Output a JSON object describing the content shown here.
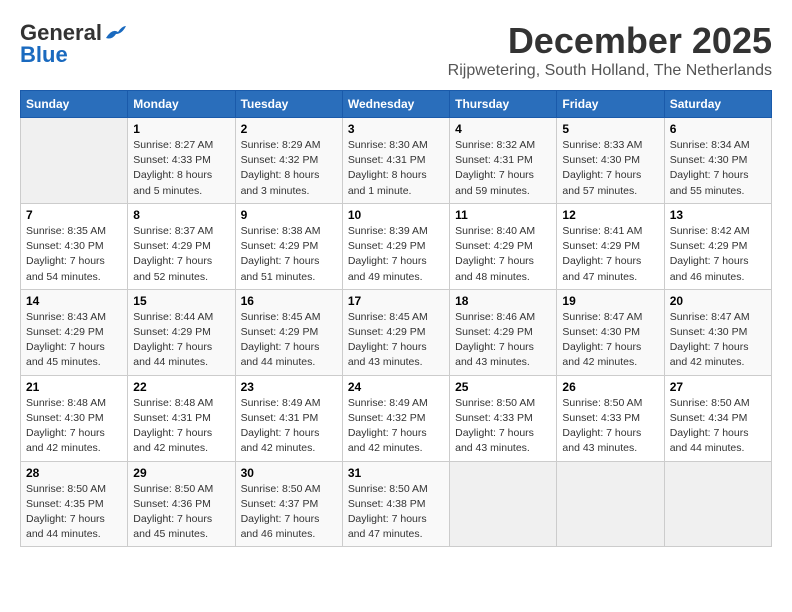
{
  "header": {
    "logo_general": "General",
    "logo_blue": "Blue",
    "title": "December 2025",
    "subtitle": "Rijpwetering, South Holland, The Netherlands"
  },
  "columns": [
    "Sunday",
    "Monday",
    "Tuesday",
    "Wednesday",
    "Thursday",
    "Friday",
    "Saturday"
  ],
  "weeks": [
    [
      {
        "day": "",
        "info": ""
      },
      {
        "day": "1",
        "info": "Sunrise: 8:27 AM\nSunset: 4:33 PM\nDaylight: 8 hours\nand 5 minutes."
      },
      {
        "day": "2",
        "info": "Sunrise: 8:29 AM\nSunset: 4:32 PM\nDaylight: 8 hours\nand 3 minutes."
      },
      {
        "day": "3",
        "info": "Sunrise: 8:30 AM\nSunset: 4:31 PM\nDaylight: 8 hours\nand 1 minute."
      },
      {
        "day": "4",
        "info": "Sunrise: 8:32 AM\nSunset: 4:31 PM\nDaylight: 7 hours\nand 59 minutes."
      },
      {
        "day": "5",
        "info": "Sunrise: 8:33 AM\nSunset: 4:30 PM\nDaylight: 7 hours\nand 57 minutes."
      },
      {
        "day": "6",
        "info": "Sunrise: 8:34 AM\nSunset: 4:30 PM\nDaylight: 7 hours\nand 55 minutes."
      }
    ],
    [
      {
        "day": "7",
        "info": "Sunrise: 8:35 AM\nSunset: 4:30 PM\nDaylight: 7 hours\nand 54 minutes."
      },
      {
        "day": "8",
        "info": "Sunrise: 8:37 AM\nSunset: 4:29 PM\nDaylight: 7 hours\nand 52 minutes."
      },
      {
        "day": "9",
        "info": "Sunrise: 8:38 AM\nSunset: 4:29 PM\nDaylight: 7 hours\nand 51 minutes."
      },
      {
        "day": "10",
        "info": "Sunrise: 8:39 AM\nSunset: 4:29 PM\nDaylight: 7 hours\nand 49 minutes."
      },
      {
        "day": "11",
        "info": "Sunrise: 8:40 AM\nSunset: 4:29 PM\nDaylight: 7 hours\nand 48 minutes."
      },
      {
        "day": "12",
        "info": "Sunrise: 8:41 AM\nSunset: 4:29 PM\nDaylight: 7 hours\nand 47 minutes."
      },
      {
        "day": "13",
        "info": "Sunrise: 8:42 AM\nSunset: 4:29 PM\nDaylight: 7 hours\nand 46 minutes."
      }
    ],
    [
      {
        "day": "14",
        "info": "Sunrise: 8:43 AM\nSunset: 4:29 PM\nDaylight: 7 hours\nand 45 minutes."
      },
      {
        "day": "15",
        "info": "Sunrise: 8:44 AM\nSunset: 4:29 PM\nDaylight: 7 hours\nand 44 minutes."
      },
      {
        "day": "16",
        "info": "Sunrise: 8:45 AM\nSunset: 4:29 PM\nDaylight: 7 hours\nand 44 minutes."
      },
      {
        "day": "17",
        "info": "Sunrise: 8:45 AM\nSunset: 4:29 PM\nDaylight: 7 hours\nand 43 minutes."
      },
      {
        "day": "18",
        "info": "Sunrise: 8:46 AM\nSunset: 4:29 PM\nDaylight: 7 hours\nand 43 minutes."
      },
      {
        "day": "19",
        "info": "Sunrise: 8:47 AM\nSunset: 4:30 PM\nDaylight: 7 hours\nand 42 minutes."
      },
      {
        "day": "20",
        "info": "Sunrise: 8:47 AM\nSunset: 4:30 PM\nDaylight: 7 hours\nand 42 minutes."
      }
    ],
    [
      {
        "day": "21",
        "info": "Sunrise: 8:48 AM\nSunset: 4:30 PM\nDaylight: 7 hours\nand 42 minutes."
      },
      {
        "day": "22",
        "info": "Sunrise: 8:48 AM\nSunset: 4:31 PM\nDaylight: 7 hours\nand 42 minutes."
      },
      {
        "day": "23",
        "info": "Sunrise: 8:49 AM\nSunset: 4:31 PM\nDaylight: 7 hours\nand 42 minutes."
      },
      {
        "day": "24",
        "info": "Sunrise: 8:49 AM\nSunset: 4:32 PM\nDaylight: 7 hours\nand 42 minutes."
      },
      {
        "day": "25",
        "info": "Sunrise: 8:50 AM\nSunset: 4:33 PM\nDaylight: 7 hours\nand 43 minutes."
      },
      {
        "day": "26",
        "info": "Sunrise: 8:50 AM\nSunset: 4:33 PM\nDaylight: 7 hours\nand 43 minutes."
      },
      {
        "day": "27",
        "info": "Sunrise: 8:50 AM\nSunset: 4:34 PM\nDaylight: 7 hours\nand 44 minutes."
      }
    ],
    [
      {
        "day": "28",
        "info": "Sunrise: 8:50 AM\nSunset: 4:35 PM\nDaylight: 7 hours\nand 44 minutes."
      },
      {
        "day": "29",
        "info": "Sunrise: 8:50 AM\nSunset: 4:36 PM\nDaylight: 7 hours\nand 45 minutes."
      },
      {
        "day": "30",
        "info": "Sunrise: 8:50 AM\nSunset: 4:37 PM\nDaylight: 7 hours\nand 46 minutes."
      },
      {
        "day": "31",
        "info": "Sunrise: 8:50 AM\nSunset: 4:38 PM\nDaylight: 7 hours\nand 47 minutes."
      },
      {
        "day": "",
        "info": ""
      },
      {
        "day": "",
        "info": ""
      },
      {
        "day": "",
        "info": ""
      }
    ]
  ]
}
